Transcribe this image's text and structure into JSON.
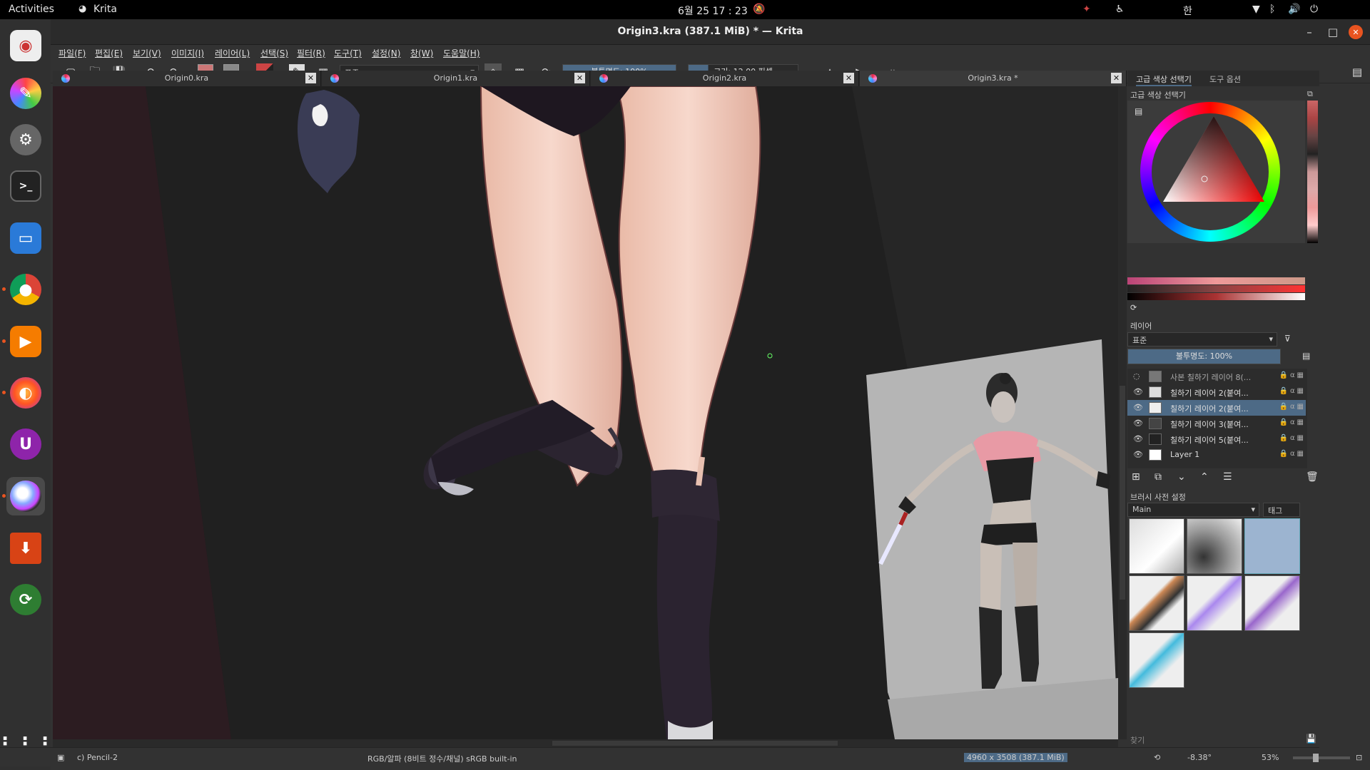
{
  "topbar": {
    "activities": "Activities",
    "app_name": "Krita",
    "clock": "6월 25  17 : 23",
    "input_method": "한"
  },
  "window": {
    "title": "Origin3.kra (387.1 MiB)  * — Krita",
    "minimize": "–",
    "maximize": "–",
    "close": "✕"
  },
  "menu": [
    "파일(F)",
    "편집(E)",
    "보기(V)",
    "이미지(I)",
    "레이어(L)",
    "선택(S)",
    "필터(R)",
    "도구(T)",
    "설정(N)",
    "창(W)",
    "도움말(H)"
  ],
  "toolbar": {
    "blend_mode": "표준",
    "opacity": "불투명도: 100%",
    "size": "크기: 12.00 픽셀"
  },
  "tabs": [
    {
      "label": "Origin0.kra",
      "close": "✕"
    },
    {
      "label": "Origin1.kra",
      "close": "✕"
    },
    {
      "label": "Origin2.kra",
      "close": "✕"
    },
    {
      "label": "Origin3.kra *",
      "close": "✕"
    }
  ],
  "dockers": {
    "tab_color": "고급 색상 선택기",
    "tab_tool": "도구 옵션",
    "color_title": "고급 색상 선택기",
    "layers_title": "레이어",
    "layers_blend": "표준",
    "layers_opacity": "불투명도: 100%",
    "layers": [
      {
        "name": "사본 칠하기 레이어 8(...",
        "visible": false
      },
      {
        "name": "칠하기 레이어 2(붙여...",
        "visible": true
      },
      {
        "name": "칠하기 레이어 2(붙여...",
        "visible": true,
        "selected": true
      },
      {
        "name": "칠하기 레이어 3(붙여...",
        "visible": true
      },
      {
        "name": "칠하기 레이어 5(붙여...",
        "visible": true
      },
      {
        "name": "Layer 1",
        "visible": true
      }
    ],
    "brush_title": "브러시 사전 설정",
    "brush_tag": "Main",
    "brush_tag_btn": "태그",
    "search_placeholder": "찾기"
  },
  "status": {
    "brush": "c) Pencil-2",
    "color_space": "RGB/알파 (8비트 정수/채널)  sRGB built-in",
    "dimensions": "4960 x 3508 (387.1 MiB)",
    "rotation": "-8.38°",
    "zoom": "53%"
  },
  "colors": {
    "accent": "#4d6a86",
    "close_btn": "#e95420"
  }
}
